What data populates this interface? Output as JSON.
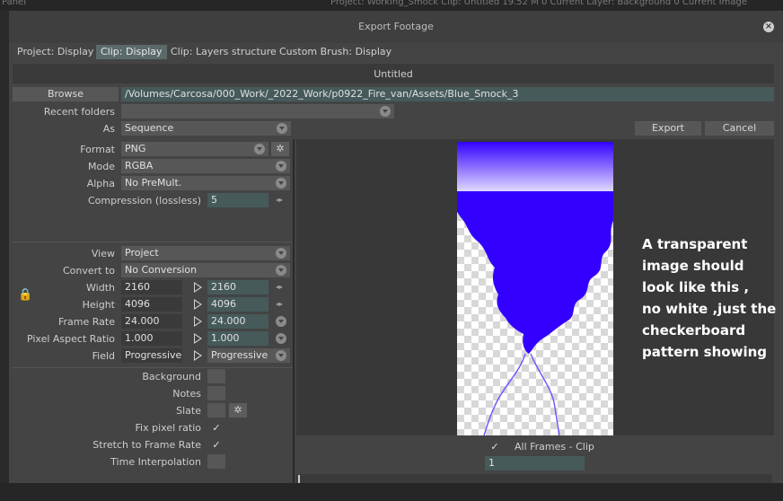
{
  "host": {
    "panel_label": "Panel",
    "project_info": "Project:  Working_Smock    Clip:  Untitled     19.52 M    0    Current Layer:  Background 0    Current Image"
  },
  "dialog": {
    "title": "Export Footage",
    "close_icon": "close-icon",
    "tabs": [
      {
        "label": "Project: Display",
        "active": false
      },
      {
        "label": "Clip: Display",
        "active": true
      },
      {
        "label": "Clip: Layers structure",
        "active": false
      },
      {
        "label": "Custom Brush: Display",
        "active": false
      }
    ],
    "clip_name": "Untitled",
    "browse_label": "Browse",
    "path": "/Volumes/Carcosa/000_Work/_2022_Work/p0922_Fire_van/Assets/Blue_Smock_3",
    "recent_folders_label": "Recent folders",
    "recent_folders_value": "",
    "as_label": "As",
    "as_value": "Sequence",
    "export_label": "Export",
    "cancel_label": "Cancel"
  },
  "format_section": {
    "format_label": "Format",
    "format_value": "PNG",
    "mode_label": "Mode",
    "mode_value": "RGBA",
    "alpha_label": "Alpha",
    "alpha_value": "No PreMult.",
    "compression_label": "Compression (lossless)",
    "compression_value": "5"
  },
  "view_section": {
    "view_label": "View",
    "view_value": "Project",
    "convert_label": "Convert to",
    "convert_value": "No Conversion",
    "width_label": "Width",
    "width_src": "2160",
    "width_dst": "2160",
    "height_label": "Height",
    "height_src": "4096",
    "height_dst": "4096",
    "framerate_label": "Frame Rate",
    "framerate_src": "24.000",
    "framerate_dst": "24.000",
    "par_label": "Pixel Aspect Ratio",
    "par_src": "1.000",
    "par_dst": "1.000",
    "field_label": "Field",
    "field_src": "Progressive",
    "field_dst": "Progressive"
  },
  "options": {
    "background_label": "Background",
    "notes_label": "Notes",
    "slate_label": "Slate",
    "fix_pixel_label": "Fix pixel ratio",
    "fix_pixel_checked": true,
    "stretch_label": "Stretch to Frame Rate",
    "stretch_checked": true,
    "time_interp_label": "Time Interpolation"
  },
  "preview": {
    "all_frames_label": "All Frames - Clip",
    "all_frames_checked": true,
    "frame_value": "1",
    "note": "A transparent\nimage  should\nlook like this ,\nno white ,just the\ncheckerboard\npattern showing",
    "smoke_color": "#3300ff"
  }
}
